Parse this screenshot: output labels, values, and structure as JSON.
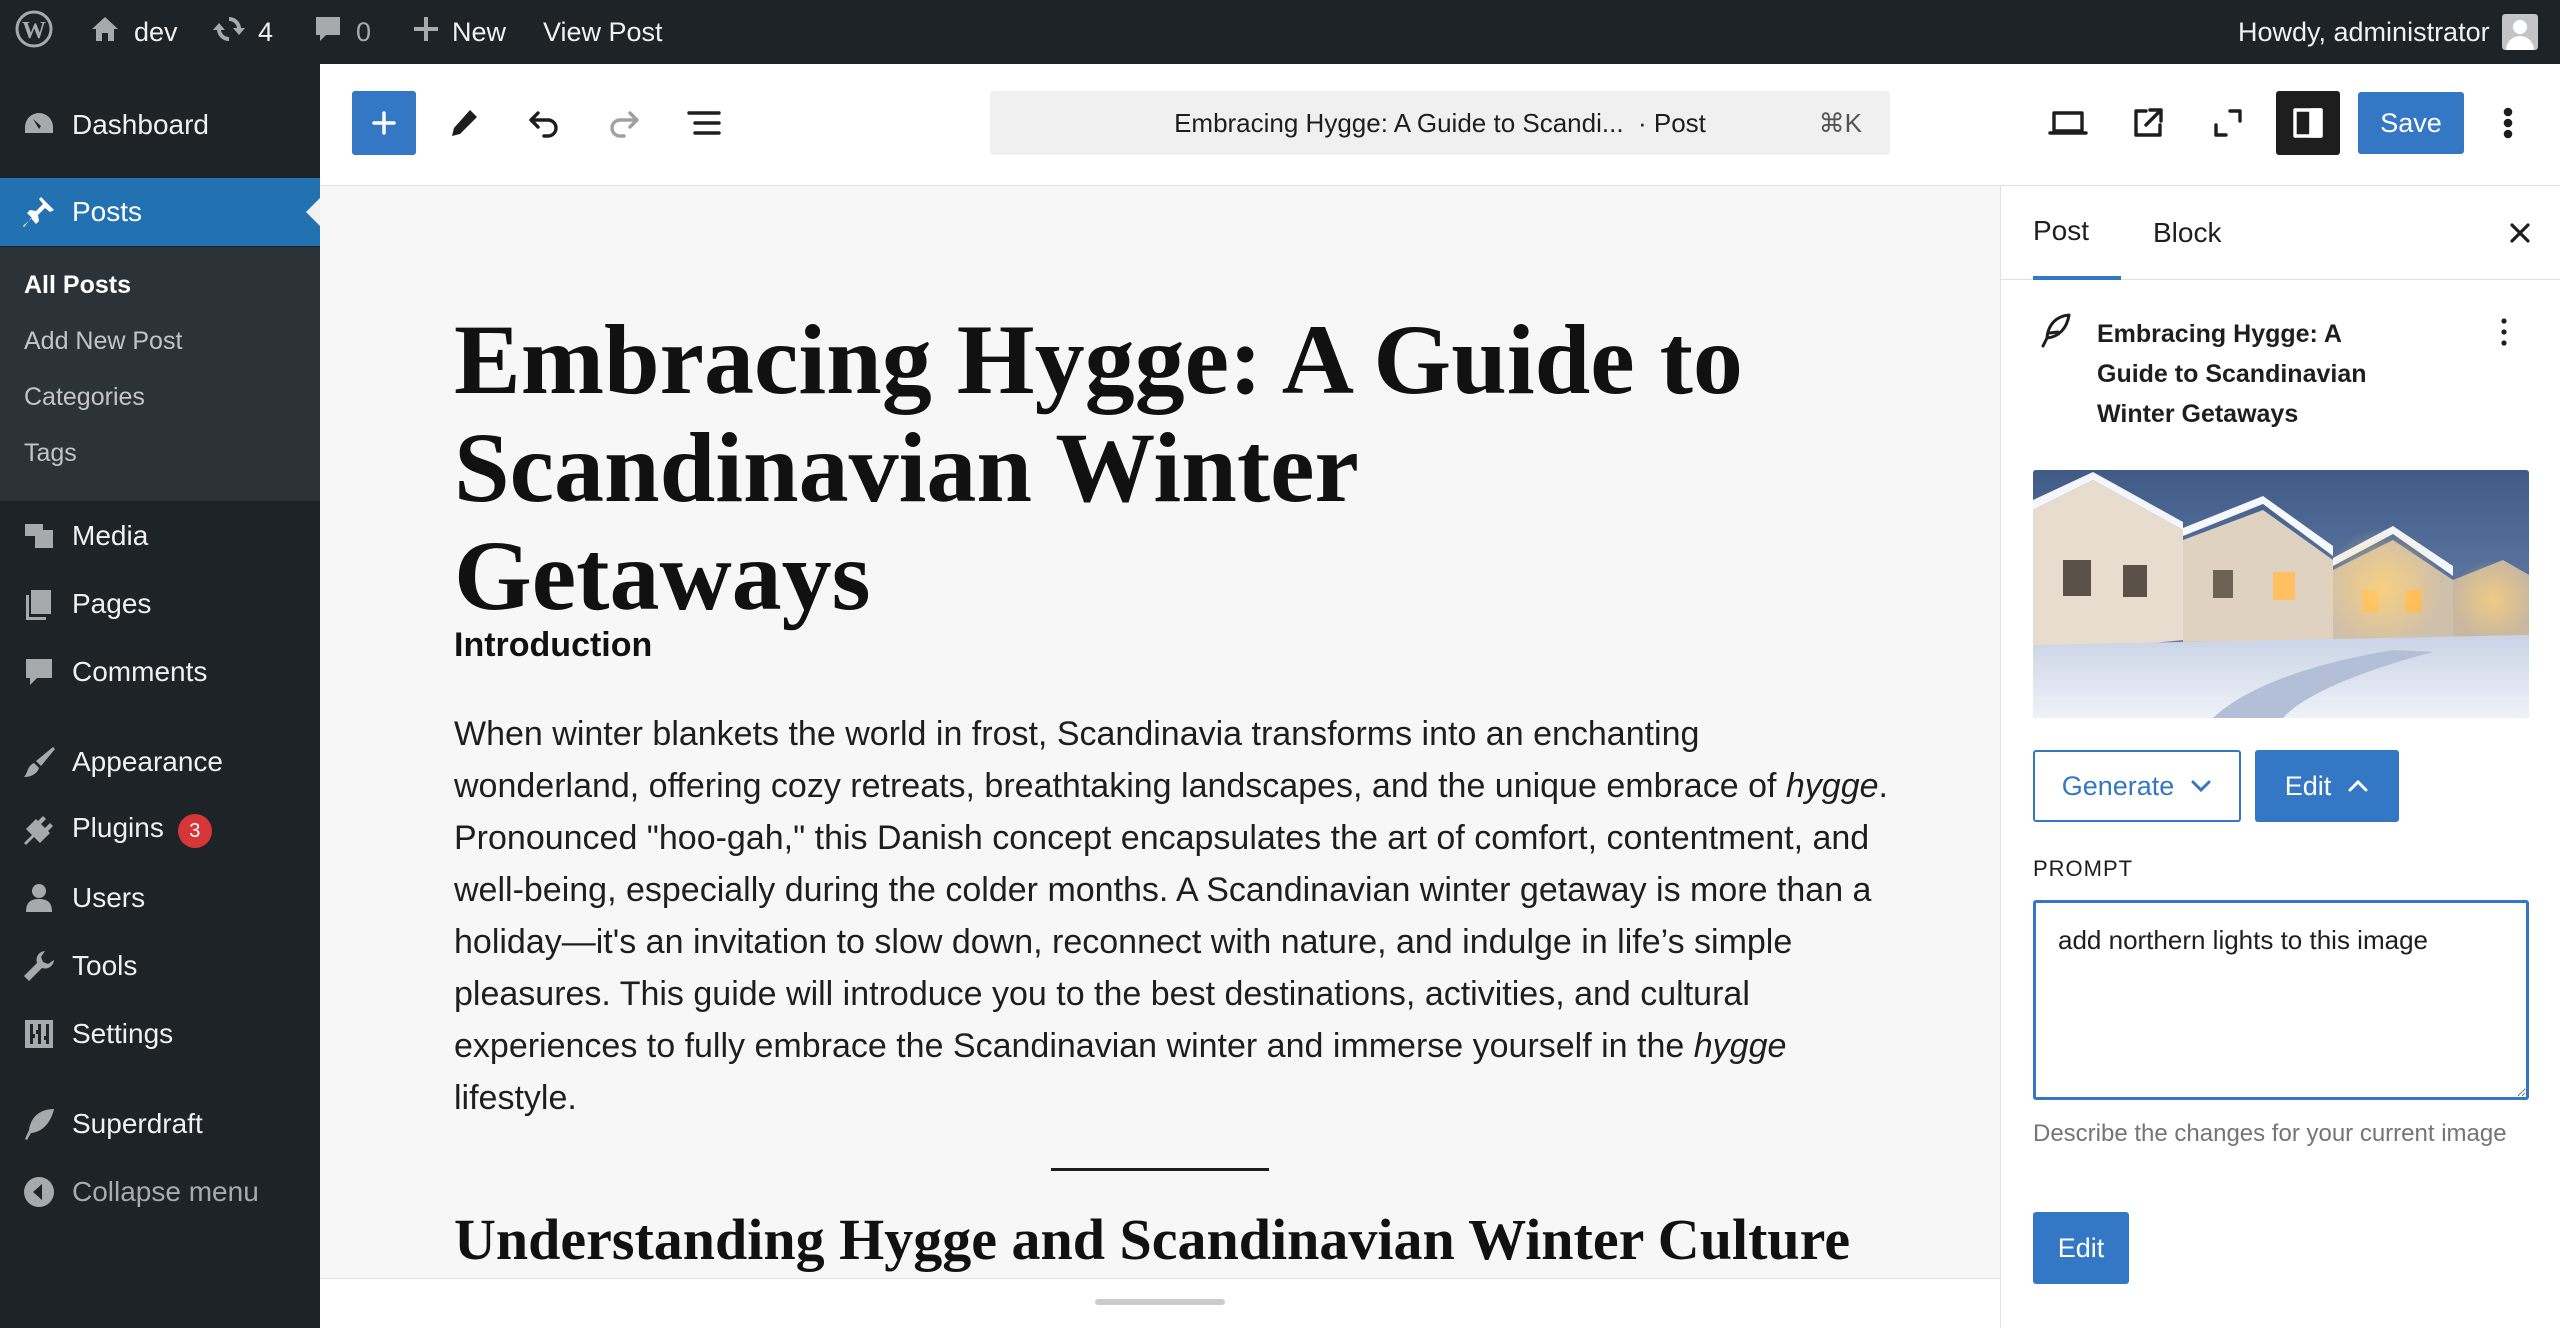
{
  "admin_bar": {
    "site_name": "dev",
    "updates_count": "4",
    "comments_count": "0",
    "new_label": "New",
    "view_post_label": "View Post",
    "howdy_text": "Howdy, administrator"
  },
  "sidebar": {
    "items": [
      {
        "label": "Dashboard",
        "icon": "dashboard-icon"
      },
      {
        "label": "Posts",
        "icon": "pin-icon"
      },
      {
        "label": "Media",
        "icon": "media-icon"
      },
      {
        "label": "Pages",
        "icon": "pages-icon"
      },
      {
        "label": "Comments",
        "icon": "comment-icon"
      },
      {
        "label": "Appearance",
        "icon": "brush-icon"
      },
      {
        "label": "Plugins",
        "icon": "plug-icon",
        "badge": "3"
      },
      {
        "label": "Users",
        "icon": "user-icon"
      },
      {
        "label": "Tools",
        "icon": "wrench-icon"
      },
      {
        "label": "Settings",
        "icon": "sliders-icon"
      },
      {
        "label": "Superdraft",
        "icon": "feather-icon"
      },
      {
        "label": "Collapse menu",
        "icon": "collapse-icon"
      }
    ],
    "submenu": [
      "All Posts",
      "Add New Post",
      "Categories",
      "Tags"
    ]
  },
  "editor": {
    "command_title": "Embracing Hygge: A Guide to Scandi...",
    "command_type": "· Post",
    "command_shortcut": "⌘K",
    "save_label": "Save"
  },
  "content": {
    "post_title": "Embracing Hygge: A Guide to Scandinavian Winter Getaways",
    "intro_heading": "Introduction",
    "intro_part1": "When winter blankets the world in frost, Scandinavia transforms into an enchanting wonderland, offering cozy retreats, breathtaking landscapes, and the unique embrace of ",
    "intro_em1": "hygge",
    "intro_part2": ". Pronounced \"hoo-gah,\" this Danish concept encapsulates the art of comfort, contentment, and well-being, especially during the colder months. A Scandinavian winter getaway is more than a holiday—it's an invitation to slow down, reconnect with nature, and indulge in life’s simple pleasures. This guide will introduce you to the best destinations, activities, and cultural experiences to fully embrace the Scandinavian winter and immerse yourself in the ",
    "intro_em2": "hygge",
    "intro_part3": " lifestyle.",
    "section_heading": "Understanding Hygge and Scandinavian Winter Culture"
  },
  "settings_panel": {
    "tab_post": "Post",
    "tab_block": "Block",
    "post_card_title": "Embracing Hygge: A Guide to Scandinavian Winter Getaways",
    "generate_label": "Generate",
    "edit_toggle_label": "Edit",
    "prompt_label": "PROMPT",
    "prompt_value": "add northern lights to this image",
    "prompt_help": "Describe the changes for your current image",
    "edit_submit_label": "Edit"
  },
  "colors": {
    "admin_dark": "#1d2327",
    "accent_blue": "#3477c4",
    "wp_current": "#2271b1",
    "badge_red": "#d63638"
  }
}
